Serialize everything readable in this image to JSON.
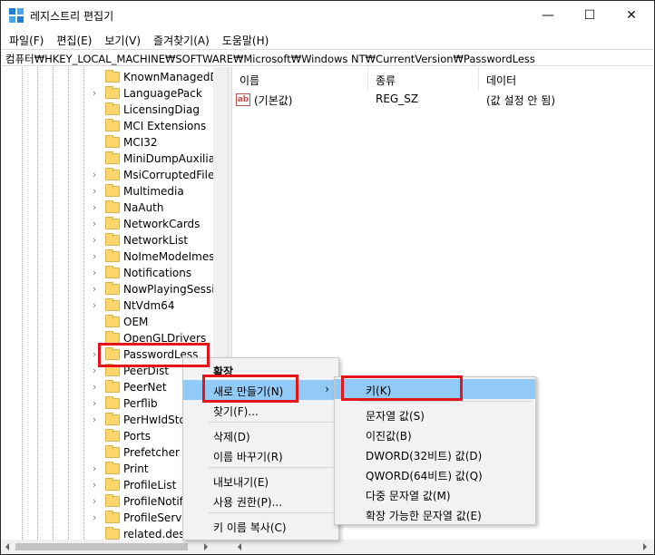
{
  "window": {
    "title": "레지스트리 편집기"
  },
  "window_controls": {
    "minimize": "—",
    "maximize": "☐",
    "close": "✕"
  },
  "menubar": [
    "파일(F)",
    "편집(E)",
    "보기(V)",
    "즐겨찾기(A)",
    "도움말(H)"
  ],
  "address": "컴퓨터₩HKEY_LOCAL_MACHINE₩SOFTWARE₩Microsoft₩Windows NT₩CurrentVersion₩PasswordLess",
  "tree": {
    "items": [
      {
        "label": "KnownManagedD",
        "expander": false
      },
      {
        "label": "LanguagePack",
        "expander": true
      },
      {
        "label": "LicensingDiag",
        "expander": false
      },
      {
        "label": "MCI Extensions",
        "expander": false
      },
      {
        "label": "MCI32",
        "expander": false
      },
      {
        "label": "MiniDumpAuxiliar",
        "expander": false
      },
      {
        "label": "MsiCorruptedFileR",
        "expander": true
      },
      {
        "label": "Multimedia",
        "expander": true
      },
      {
        "label": "NaAuth",
        "expander": true
      },
      {
        "label": "NetworkCards",
        "expander": true
      },
      {
        "label": "NetworkList",
        "expander": true
      },
      {
        "label": "NoImeModeImes",
        "expander": true
      },
      {
        "label": "Notifications",
        "expander": true
      },
      {
        "label": "NowPlayingSessio",
        "expander": true
      },
      {
        "label": "NtVdm64",
        "expander": true
      },
      {
        "label": "OEM",
        "expander": false
      },
      {
        "label": "OpenGLDrivers",
        "expander": false
      },
      {
        "label": "PasswordLess",
        "expander": true,
        "selected": true
      },
      {
        "label": "PeerDist",
        "expander": true
      },
      {
        "label": "PeerNet",
        "expander": true
      },
      {
        "label": "Perflib",
        "expander": true
      },
      {
        "label": "PerHwIdSto",
        "expander": true
      },
      {
        "label": "Ports",
        "expander": false
      },
      {
        "label": "Prefetcher",
        "expander": false
      },
      {
        "label": "Print",
        "expander": true
      },
      {
        "label": "ProfileList",
        "expander": true
      },
      {
        "label": "ProfileNotifi",
        "expander": true
      },
      {
        "label": "ProfileServic",
        "expander": true
      },
      {
        "label": "related.desc",
        "expander": false
      }
    ]
  },
  "list": {
    "headers": {
      "name": "이름",
      "type": "종류",
      "data": "데이터"
    },
    "rows": [
      {
        "icon": "ab",
        "name": "(기본값)",
        "type": "REG_SZ",
        "data": "(값 설정 안 됨)"
      }
    ]
  },
  "context_menu": {
    "items": [
      {
        "label": "확장",
        "bold": true
      },
      {
        "label": "새로 만들기(N)",
        "submenu_arrow": "›",
        "highlighted": true
      },
      {
        "label": "찾기(F)..."
      },
      {
        "label": "삭제(D)"
      },
      {
        "label": "이름 바꾸기(R)"
      },
      {
        "label": "내보내기(E)"
      },
      {
        "label": "사용 권한(P)..."
      },
      {
        "label": "키 이름 복사(C)"
      }
    ]
  },
  "submenu": {
    "items": [
      {
        "label": "키(K)",
        "highlighted": true
      },
      {
        "label": "문자열 값(S)"
      },
      {
        "label": "이진값(B)"
      },
      {
        "label": "DWORD(32비트) 값(D)"
      },
      {
        "label": "QWORD(64비트) 값(Q)"
      },
      {
        "label": "다중 문자열 값(M)"
      },
      {
        "label": "확장 가능한 문자열 값(E)"
      }
    ]
  },
  "colors": {
    "highlight": "#91c9f7",
    "annotation_red": "#e3151a",
    "folder": "#ffd66b"
  }
}
